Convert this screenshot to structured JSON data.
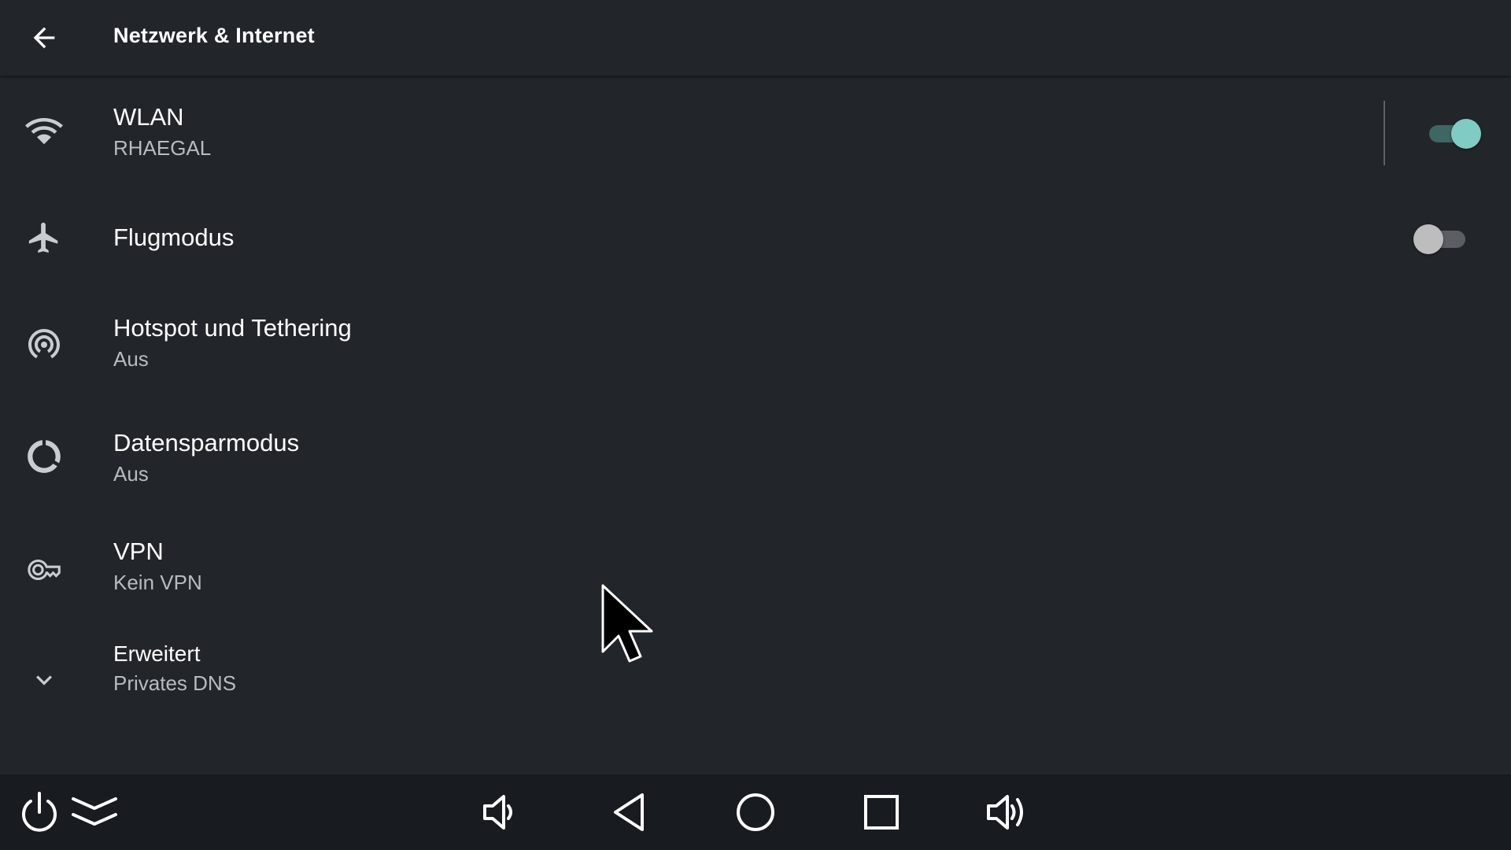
{
  "header": {
    "title": "Netzwerk & Internet",
    "back_icon": "arrow-back-icon"
  },
  "settings": {
    "wlan": {
      "label": "WLAN",
      "summary": "RHAEGAL",
      "icon": "wifi-icon",
      "switch_on": true
    },
    "airplane": {
      "label": "Flugmodus",
      "icon": "airplane-icon",
      "switch_on": false
    },
    "hotspot": {
      "label": "Hotspot und Tethering",
      "summary": "Aus",
      "icon": "hotspot-icon"
    },
    "data_saver": {
      "label": "Datensparmodus",
      "summary": "Aus",
      "icon": "data-saver-icon"
    },
    "vpn": {
      "label": "VPN",
      "summary": "Kein VPN",
      "icon": "key-icon"
    },
    "advanced": {
      "label": "Erweitert",
      "summary": "Privates DNS",
      "icon": "chevron-down-icon"
    }
  },
  "navbar": {
    "items": [
      "power-icon",
      "notifications-expand-icon",
      "volume-down-icon",
      "nav-back-icon",
      "nav-home-icon",
      "nav-recents-icon",
      "volume-up-icon"
    ]
  },
  "colors": {
    "background": "#22262b",
    "navbar_background": "#181b1f",
    "accent": "#80cbc4",
    "text_primary": "#ffffff",
    "text_secondary": "#b7bcc1",
    "icon": "#c9cdd1"
  }
}
